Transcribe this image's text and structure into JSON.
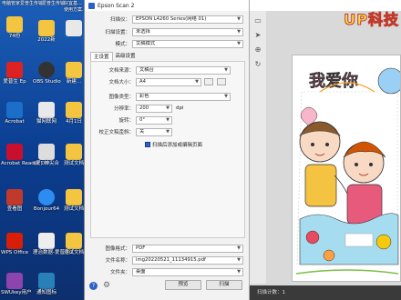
{
  "desktop": {
    "top_labels": [
      "电脑管家",
      "爱普生传输",
      "爱普生传输",
      "好宜基...",
      "使用方案..."
    ],
    "icons": [
      {
        "label": "74份",
        "icon": "folder-icon"
      },
      {
        "label": "2022新",
        "icon": "folder-icon"
      },
      {
        "label": "爱普生 Ep",
        "icon": "app-icon"
      },
      {
        "label": "OBS Studio",
        "icon": "obs-icon"
      },
      {
        "label": "新建...",
        "icon": "folder-icon"
      },
      {
        "label": "Acrobat",
        "icon": "acrobat-icon"
      },
      {
        "label": "猫网联网",
        "icon": "app-icon"
      },
      {
        "label": "4月1日",
        "icon": "folder-icon"
      },
      {
        "label": "Acrobat Reader DC",
        "icon": "acrobat-icon"
      },
      {
        "label": "(爱) 神尖合",
        "icon": "file-icon"
      },
      {
        "label": "测试文档",
        "icon": "folder-icon"
      },
      {
        "label": "查看图",
        "icon": "app-icon"
      },
      {
        "label": "Bonjour64",
        "icon": "bonjour-icon"
      },
      {
        "label": "测试文档",
        "icon": "folder-icon"
      },
      {
        "label": "WPS Office",
        "icon": "wps-icon"
      },
      {
        "label": "理治数据-爱普生2",
        "icon": "file-icon"
      },
      {
        "label": "测试文档",
        "icon": "folder-icon"
      },
      {
        "label": "SWUkey用户",
        "icon": "app-icon"
      },
      {
        "label": "通知图标",
        "icon": "app-icon"
      }
    ]
  },
  "scan": {
    "title": "Epson Scan 2",
    "scanner_label": "扫描仪：",
    "scanner_value": "EPSON L4260 Series(网络 01)",
    "settings_label": "扫描设置：",
    "settings_value": "未选择",
    "mode_label": "模式：",
    "mode_value": "文稿模式",
    "tab_main": "主设置",
    "tab_advanced": "高级设置",
    "source_label": "文档来源：",
    "source_value": "文稿台",
    "size_label": "文档大小：",
    "size_value": "A4",
    "image_type_label": "图像类型：",
    "image_type_value": "彩色",
    "resolution_label": "分辨率：",
    "resolution_value": "200",
    "resolution_unit": "dpi",
    "rotate_label": "旋转：",
    "rotate_value": "0°",
    "correct_label": "校正文稿歪斜：",
    "correct_value": "关",
    "add_edit_label": "扫描后添加或编辑页面",
    "format_label": "图像格式：",
    "format_value": "PDF",
    "filename_label": "文件名称：",
    "filename_value": "img20220521_11134915.pdf",
    "folder_label": "文件夹：",
    "folder_value": "桌面",
    "preview_button": "预览",
    "scan_button": "扫描"
  },
  "preview": {
    "watermark": "UP科技",
    "status": "扫描计数：1",
    "artwork_title": "我爱你"
  },
  "colors": {
    "accent": "#2a62c9",
    "status_bar": "#3a3a3a",
    "watermark": "#ffe24a"
  }
}
